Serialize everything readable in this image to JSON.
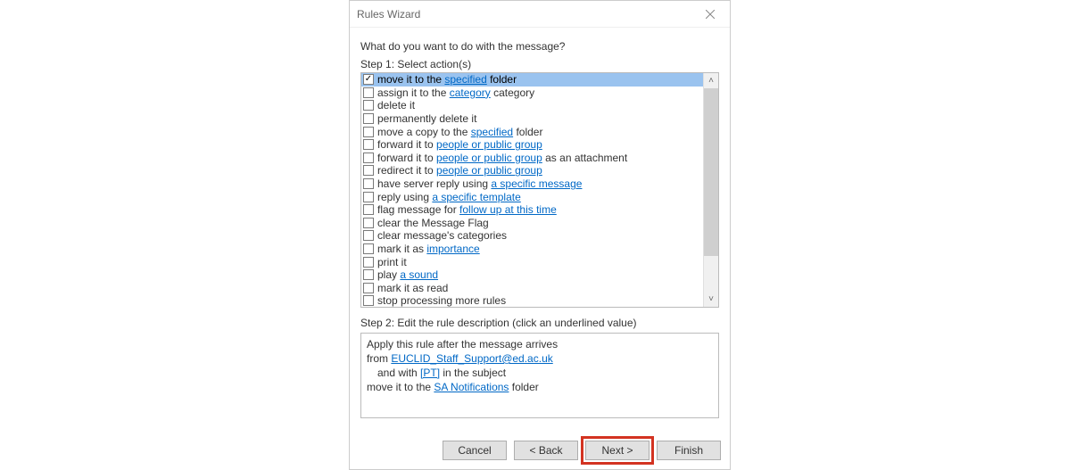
{
  "dialog": {
    "title": "Rules Wizard",
    "prompt": "What do you want to do with the message?",
    "step1_label": "Step 1: Select action(s)",
    "step2_label": "Step 2: Edit the rule description (click an underlined value)"
  },
  "actions": [
    {
      "checked": true,
      "selected": true,
      "parts": [
        {
          "t": "move it to the "
        },
        {
          "t": "specified",
          "link": true
        },
        {
          "t": " folder"
        }
      ]
    },
    {
      "checked": false,
      "selected": false,
      "parts": [
        {
          "t": "assign it to the "
        },
        {
          "t": "category",
          "link": true
        },
        {
          "t": " category"
        }
      ]
    },
    {
      "checked": false,
      "selected": false,
      "parts": [
        {
          "t": "delete it"
        }
      ]
    },
    {
      "checked": false,
      "selected": false,
      "parts": [
        {
          "t": "permanently delete it"
        }
      ]
    },
    {
      "checked": false,
      "selected": false,
      "parts": [
        {
          "t": "move a copy to the "
        },
        {
          "t": "specified",
          "link": true
        },
        {
          "t": " folder"
        }
      ]
    },
    {
      "checked": false,
      "selected": false,
      "parts": [
        {
          "t": "forward it to "
        },
        {
          "t": "people or public group",
          "link": true
        }
      ]
    },
    {
      "checked": false,
      "selected": false,
      "parts": [
        {
          "t": "forward it to "
        },
        {
          "t": "people or public group",
          "link": true
        },
        {
          "t": " as an attachment"
        }
      ]
    },
    {
      "checked": false,
      "selected": false,
      "parts": [
        {
          "t": "redirect it to "
        },
        {
          "t": "people or public group",
          "link": true
        }
      ]
    },
    {
      "checked": false,
      "selected": false,
      "parts": [
        {
          "t": "have server reply using "
        },
        {
          "t": "a specific message",
          "link": true
        }
      ]
    },
    {
      "checked": false,
      "selected": false,
      "parts": [
        {
          "t": "reply using "
        },
        {
          "t": "a specific template",
          "link": true
        }
      ]
    },
    {
      "checked": false,
      "selected": false,
      "parts": [
        {
          "t": "flag message for "
        },
        {
          "t": "follow up at this time",
          "link": true
        }
      ]
    },
    {
      "checked": false,
      "selected": false,
      "parts": [
        {
          "t": "clear the Message Flag"
        }
      ]
    },
    {
      "checked": false,
      "selected": false,
      "parts": [
        {
          "t": "clear message's categories"
        }
      ]
    },
    {
      "checked": false,
      "selected": false,
      "parts": [
        {
          "t": "mark it as "
        },
        {
          "t": "importance",
          "link": true
        }
      ]
    },
    {
      "checked": false,
      "selected": false,
      "parts": [
        {
          "t": "print it"
        }
      ]
    },
    {
      "checked": false,
      "selected": false,
      "parts": [
        {
          "t": "play "
        },
        {
          "t": "a sound",
          "link": true
        }
      ]
    },
    {
      "checked": false,
      "selected": false,
      "parts": [
        {
          "t": "mark it as read"
        }
      ]
    },
    {
      "checked": false,
      "selected": false,
      "parts": [
        {
          "t": "stop processing more rules"
        }
      ]
    }
  ],
  "description": {
    "line1_prefix": "Apply this rule after the message arrives",
    "line2_prefix": "from ",
    "line2_link": "EUCLID_Staff_Support@ed.ac.uk",
    "line3_prefix": "and with ",
    "line3_link": "[PT]",
    "line3_suffix": " in the subject",
    "line4_prefix": "move it to the ",
    "line4_link": "SA Notifications",
    "line4_suffix": " folder"
  },
  "buttons": {
    "cancel": "Cancel",
    "back": "< Back",
    "next": "Next >",
    "finish": "Finish"
  }
}
